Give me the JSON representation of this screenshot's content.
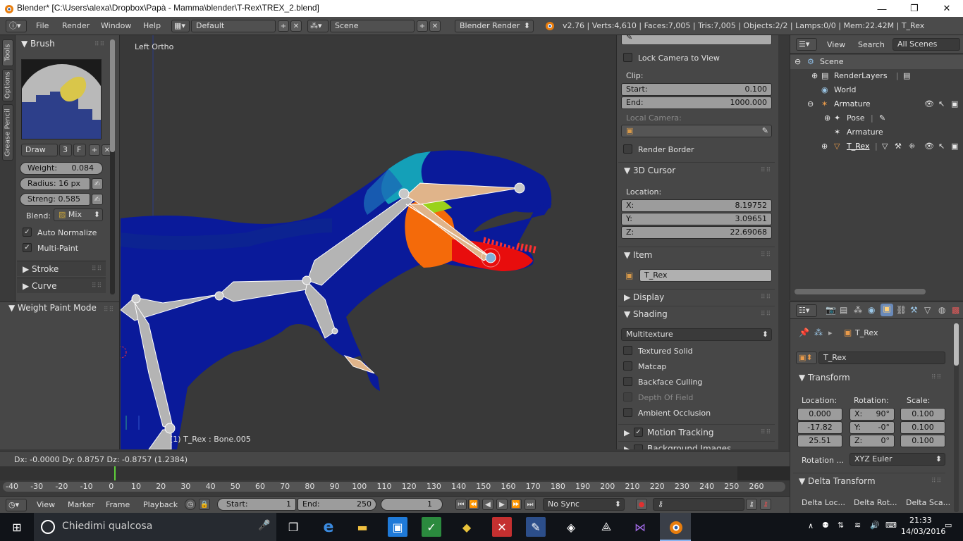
{
  "window": {
    "title": "Blender* [C:\\Users\\alexa\\Dropbox\\Papà - Mamma\\blender\\T-Rex\\TREX_2.blend]",
    "minimize": "—",
    "maximize": "❐",
    "close": "✕"
  },
  "menubar": {
    "menus": [
      "File",
      "Render",
      "Window",
      "Help"
    ],
    "layout": "Default",
    "scene": "Scene",
    "engine": "Blender Render",
    "stats": "v2.76 | Verts:4,610 | Faces:7,005 | Tris:7,005 | Objects:2/2 | Lamps:0/0 | Mem:22.42M | T_Rex"
  },
  "tools": {
    "tabs": [
      "Tools",
      "Options",
      "Grease Pencil"
    ],
    "brush_header": "Brush",
    "brush_name": "Draw",
    "brush_users": "3",
    "brush_fake": "F",
    "weight_label": "Weight:",
    "weight_value": "0.084",
    "radius_label": "Radius: 16 px",
    "strength_label": "Streng: 0.585",
    "blend_label": "Blend:",
    "blend_value": "Mix",
    "auto_normalize": "Auto Normalize",
    "multi_paint": "Multi-Paint",
    "stroke": "Stroke",
    "curve": "Curve",
    "mode_panel": "Weight Paint Mode"
  },
  "viewport": {
    "view_name": "Left Ortho",
    "object_info": "(1) T_Rex : Bone.005"
  },
  "npanel": {
    "lock_camera": "Lock Camera to View",
    "clip_label": "Clip:",
    "clip_start_label": "Start:",
    "clip_start": "0.100",
    "clip_end_label": "End:",
    "clip_end": "1000.000",
    "local_camera": "Local Camera:",
    "render_border": "Render Border",
    "cursor_header": "3D Cursor",
    "location_label": "Location:",
    "cx_label": "X:",
    "cx": "8.19752",
    "cy_label": "Y:",
    "cy": "3.09651",
    "cz_label": "Z:",
    "cz": "22.69068",
    "item_header": "Item",
    "item_name": "T_Rex",
    "display_header": "Display",
    "shading_header": "Shading",
    "shading_mode": "Multitexture",
    "textured_solid": "Textured Solid",
    "matcap": "Matcap",
    "backface": "Backface Culling",
    "dof": "Depth Of Field",
    "ao": "Ambient Occlusion",
    "motion_tracking": "Motion Tracking",
    "background_images": "Background Images"
  },
  "outliner": {
    "view": "View",
    "search": "Search",
    "filter": "All Scenes",
    "items": [
      "Scene",
      "RenderLayers",
      "World",
      "Armature",
      "Pose",
      "Armature",
      "T_Rex"
    ]
  },
  "properties": {
    "breadcrumb": "T_Rex",
    "object_name": "T_Rex",
    "transform_header": "Transform",
    "location_label": "Location:",
    "rotation_label": "Rotation:",
    "scale_label": "Scale:",
    "loc": [
      "0.000",
      "-17.82",
      "25.51"
    ],
    "rot": [
      "X:",
      "90°",
      "Y:",
      "-0°",
      "Z:",
      "0°"
    ],
    "scale": [
      "0.100",
      "0.100",
      "0.100"
    ],
    "rotation_mode_label": "Rotation ...",
    "rotation_mode": "XYZ Euler",
    "delta_header": "Delta Transform",
    "delta_cols": [
      "Delta Loc...",
      "Delta Rot...",
      "Delta Sca..."
    ]
  },
  "statusline": {
    "text": "Dx: -0.0000   Dy: 0.8757   Dz: -0.8757 (1.2384)"
  },
  "timeline": {
    "ticks": [
      "-40",
      "-30",
      "-20",
      "-10",
      "0",
      "10",
      "20",
      "30",
      "40",
      "50",
      "60",
      "70",
      "80",
      "90",
      "100",
      "110",
      "120",
      "130",
      "140",
      "150",
      "160",
      "170",
      "180",
      "190",
      "200",
      "210",
      "220",
      "230",
      "240",
      "250",
      "260"
    ],
    "current_frame_marker": 0,
    "menus": [
      "View",
      "Marker",
      "Frame",
      "Playback"
    ],
    "start_label": "Start:",
    "start": "1",
    "end_label": "End:",
    "end": "250",
    "current": "1",
    "sync": "No Sync"
  },
  "taskbar": {
    "search": "Chiedimi qualcosa",
    "time": "21:33",
    "date": "14/03/2016"
  }
}
